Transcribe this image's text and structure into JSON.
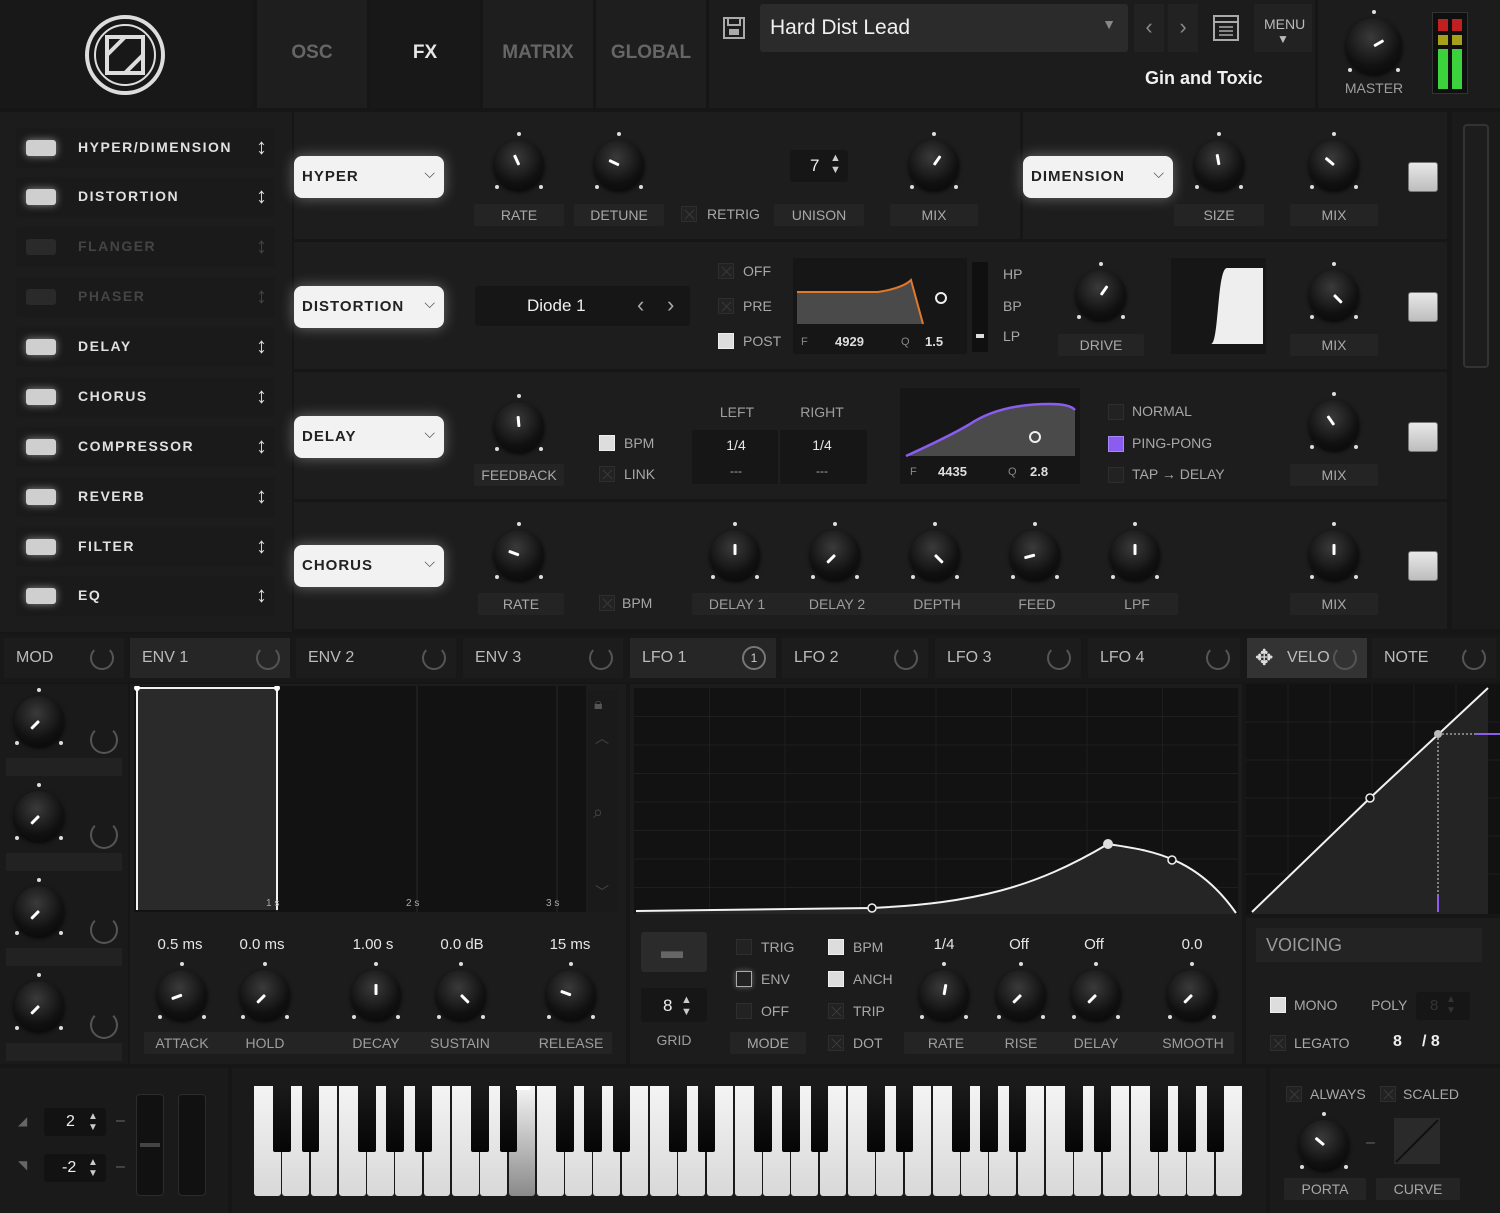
{
  "top_tabs": [
    "OSC",
    "FX",
    "MATRIX",
    "GLOBAL"
  ],
  "preset": {
    "name": "Hard Dist Lead",
    "author": "Gin and Toxic",
    "menu_label": "MENU"
  },
  "master": {
    "label": "MASTER"
  },
  "fx_list": [
    {
      "name": "HYPER/DIMENSION",
      "enabled": true
    },
    {
      "name": "DISTORTION",
      "enabled": true
    },
    {
      "name": "FLANGER",
      "enabled": false
    },
    {
      "name": "PHASER",
      "enabled": false
    },
    {
      "name": "DELAY",
      "enabled": true
    },
    {
      "name": "CHORUS",
      "enabled": true
    },
    {
      "name": "COMPRESSOR",
      "enabled": true
    },
    {
      "name": "REVERB",
      "enabled": true
    },
    {
      "name": "FILTER",
      "enabled": true
    },
    {
      "name": "EQ",
      "enabled": true
    }
  ],
  "hyper": {
    "title": "HYPER",
    "rate": "RATE",
    "detune": "DETUNE",
    "retrig": "RETRIG",
    "unison_value": "7",
    "unison": "UNISON",
    "mix": "MIX"
  },
  "dimension": {
    "title": "DIMENSION",
    "size": "SIZE",
    "mix": "MIX"
  },
  "distortion": {
    "title": "DISTORTION",
    "type": "Diode 1",
    "off": "OFF",
    "pre": "PRE",
    "post": "POST",
    "f_label": "F",
    "f_value": "4929",
    "q_label": "Q",
    "q_value": "1.5",
    "hp": "HP",
    "bp": "BP",
    "lp": "LP",
    "drive": "DRIVE",
    "mix": "MIX"
  },
  "delay": {
    "title": "DELAY",
    "feedback": "FEEDBACK",
    "bpm": "BPM",
    "link": "LINK",
    "left": "LEFT",
    "right": "RIGHT",
    "left_val": "1/4",
    "right_val": "1/4",
    "left_sub": "---",
    "right_sub": "---",
    "f_label": "F",
    "f_value": "4435",
    "q_label": "Q",
    "q_value": "2.8",
    "normal": "NORMAL",
    "pingpong": "PING-PONG",
    "tap": "TAP → DELAY",
    "mix": "MIX"
  },
  "chorus": {
    "title": "CHORUS",
    "rate": "RATE",
    "bpm": "BPM",
    "delay1": "DELAY 1",
    "delay2": "DELAY 2",
    "depth": "DEPTH",
    "feed": "FEED",
    "lpf": "LPF",
    "mix": "MIX"
  },
  "mod_tabs": [
    {
      "label": "MOD"
    },
    {
      "label": "ENV 1"
    },
    {
      "label": "ENV 2"
    },
    {
      "label": "ENV 3"
    },
    {
      "label": "LFO 1",
      "badge": "1"
    },
    {
      "label": "LFO 2"
    },
    {
      "label": "LFO 3"
    },
    {
      "label": "LFO 4"
    },
    {
      "label": "VELO"
    },
    {
      "label": "NOTE"
    }
  ],
  "env": {
    "time_labels": [
      "1 s",
      "2 s",
      "3 s"
    ],
    "values": [
      "0.5 ms",
      "0.0 ms",
      "1.00 s",
      "0.0 dB",
      "15 ms"
    ],
    "labels": [
      "ATTACK",
      "HOLD",
      "DECAY",
      "SUSTAIN",
      "RELEASE"
    ]
  },
  "lfo": {
    "grid_value": "8",
    "grid": "GRID",
    "trig": "TRIG",
    "env": "ENV",
    "off": "OFF",
    "mode": "MODE",
    "bpm": "BPM",
    "anch": "ANCH",
    "trip": "TRIP",
    "dot": "DOT",
    "values": [
      "1/4",
      "Off",
      "Off",
      "0.0"
    ],
    "labels": [
      "RATE",
      "RISE",
      "DELAY",
      "SMOOTH"
    ]
  },
  "voicing": {
    "title": "VOICING",
    "mono": "MONO",
    "poly": "POLY",
    "poly_value": "8",
    "legato": "LEGATO",
    "voices": "8",
    "voices_max": "/ 8"
  },
  "keyboard": {
    "pitch_up": "2",
    "pitch_down": "-2"
  },
  "porta": {
    "always": "ALWAYS",
    "scaled": "SCALED",
    "porta": "PORTA",
    "curve": "CURVE"
  },
  "colors": {
    "accent_orange": "#e07a2a",
    "accent_purple": "#8a5cf0",
    "meter_green": "#3bd23b"
  }
}
